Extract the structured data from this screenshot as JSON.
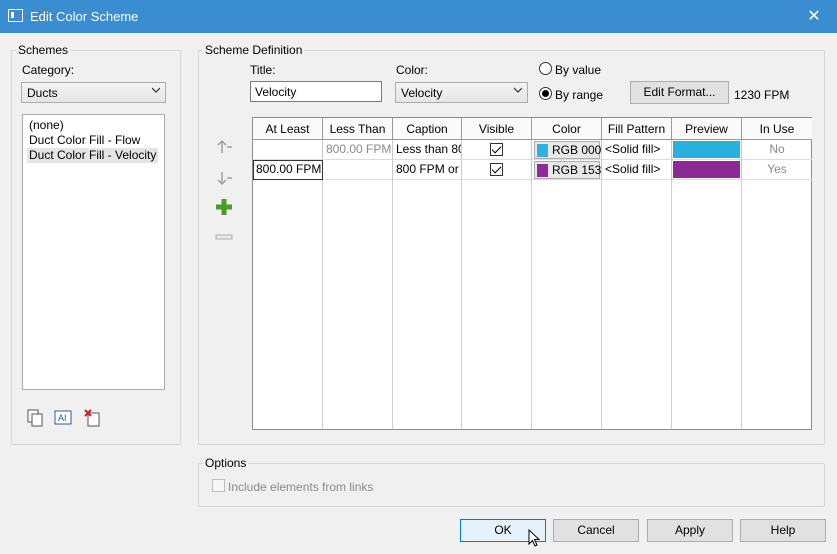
{
  "window": {
    "title": "Edit Color Scheme",
    "close_glyph": "✕"
  },
  "schemes": {
    "group_label": "Schemes",
    "category_label": "Category:",
    "category_value": "Ducts",
    "items": [
      "(none)",
      "Duct Color Fill - Flow",
      "Duct Color Fill - Velocity"
    ],
    "selected_index": 2
  },
  "definition": {
    "group_label": "Scheme Definition",
    "title_label": "Title:",
    "title_value": "Velocity",
    "color_label": "Color:",
    "color_value": "Velocity",
    "by_value_label": "By value",
    "by_range_label": "By range",
    "selected_mode": "By range",
    "edit_format_label": "Edit Format...",
    "units_text": "1230 FPM"
  },
  "table": {
    "headers": [
      "At Least",
      "Less Than",
      "Caption",
      "Visible",
      "Color",
      "Fill Pattern",
      "Preview",
      "In Use"
    ],
    "rows": [
      {
        "at_least": "",
        "less_than": "800.00 FPM",
        "caption": "Less than 80",
        "visible": true,
        "color_text": "RGB 000",
        "color_hex": "#2fb2e0",
        "fill_pattern": "<Solid fill>",
        "preview_hex": "#27b1de",
        "in_use": "No"
      },
      {
        "at_least": "800.00 FPM",
        "less_than": "",
        "caption": "800 FPM or",
        "visible": true,
        "color_text": "RGB 153",
        "color_hex": "#8e2b96",
        "fill_pattern": "<Solid fill>",
        "preview_hex": "#8c2a94",
        "in_use": "Yes"
      }
    ]
  },
  "options": {
    "group_label": "Options",
    "include_links_label": "Include elements from links",
    "include_links_checked": false
  },
  "buttons": {
    "ok": "OK",
    "cancel": "Cancel",
    "apply": "Apply",
    "help": "Help"
  },
  "icons": {
    "move_up": "arrow-up-icon",
    "move_down": "arrow-down-icon",
    "add": "plus-icon",
    "remove": "minus-icon",
    "duplicate": "duplicate-icon",
    "rename": "rename-icon",
    "delete": "delete-icon"
  },
  "colors": {
    "accent": "#3a8dd0",
    "add_green": "#4a9a2a",
    "delete_red": "#d02020"
  }
}
